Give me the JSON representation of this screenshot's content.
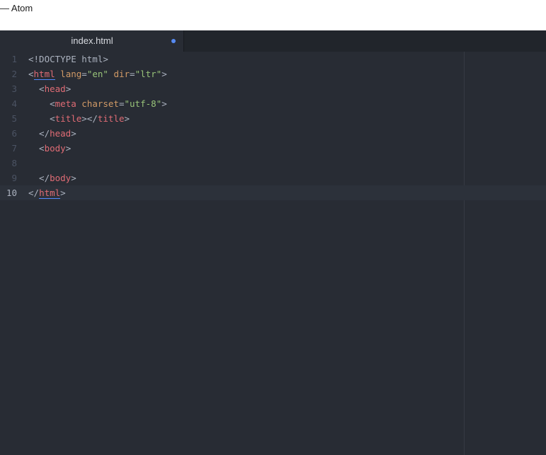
{
  "window": {
    "title": "— Atom"
  },
  "tabs": [
    {
      "label": "index.html",
      "modified": true
    }
  ],
  "colors": {
    "editor_bg": "#282c34",
    "tabbar_bg": "#21252b",
    "tag": "#e06c75",
    "attribute": "#d19a66",
    "string": "#98c379",
    "punctuation": "#abb2bf",
    "modified_dot": "#568af2",
    "bracket_match": "#528bff"
  },
  "editor": {
    "cursor_line": 10,
    "lines": [
      {
        "num": "1",
        "tokens": [
          {
            "t": "<!DOCTYPE html>",
            "c": "punct"
          }
        ]
      },
      {
        "num": "2",
        "tokens": [
          {
            "t": "<",
            "c": "punct"
          },
          {
            "t": "html",
            "c": "tag",
            "match": true
          },
          {
            "t": " ",
            "c": "punct"
          },
          {
            "t": "lang",
            "c": "attr"
          },
          {
            "t": "=",
            "c": "punct"
          },
          {
            "t": "\"en\"",
            "c": "str"
          },
          {
            "t": " ",
            "c": "punct"
          },
          {
            "t": "dir",
            "c": "attr"
          },
          {
            "t": "=",
            "c": "punct"
          },
          {
            "t": "\"ltr\"",
            "c": "str"
          },
          {
            "t": ">",
            "c": "punct"
          }
        ]
      },
      {
        "num": "3",
        "tokens": [
          {
            "t": "  <",
            "c": "punct"
          },
          {
            "t": "head",
            "c": "tag"
          },
          {
            "t": ">",
            "c": "punct"
          }
        ]
      },
      {
        "num": "4",
        "tokens": [
          {
            "t": "    <",
            "c": "punct"
          },
          {
            "t": "meta",
            "c": "tag"
          },
          {
            "t": " ",
            "c": "punct"
          },
          {
            "t": "charset",
            "c": "attr"
          },
          {
            "t": "=",
            "c": "punct"
          },
          {
            "t": "\"utf-8\"",
            "c": "str"
          },
          {
            "t": ">",
            "c": "punct"
          }
        ]
      },
      {
        "num": "5",
        "tokens": [
          {
            "t": "    <",
            "c": "punct"
          },
          {
            "t": "title",
            "c": "tag"
          },
          {
            "t": "></",
            "c": "punct"
          },
          {
            "t": "title",
            "c": "tag"
          },
          {
            "t": ">",
            "c": "punct"
          }
        ]
      },
      {
        "num": "6",
        "tokens": [
          {
            "t": "  </",
            "c": "punct"
          },
          {
            "t": "head",
            "c": "tag"
          },
          {
            "t": ">",
            "c": "punct"
          }
        ]
      },
      {
        "num": "7",
        "tokens": [
          {
            "t": "  <",
            "c": "punct"
          },
          {
            "t": "body",
            "c": "tag"
          },
          {
            "t": ">",
            "c": "punct"
          }
        ]
      },
      {
        "num": "8",
        "tokens": []
      },
      {
        "num": "9",
        "tokens": [
          {
            "t": "  </",
            "c": "punct"
          },
          {
            "t": "body",
            "c": "tag"
          },
          {
            "t": ">",
            "c": "punct"
          }
        ]
      },
      {
        "num": "10",
        "tokens": [
          {
            "t": "</",
            "c": "punct"
          },
          {
            "t": "html",
            "c": "tag",
            "match": true
          },
          {
            "t": ">",
            "c": "punct"
          }
        ]
      }
    ]
  }
}
